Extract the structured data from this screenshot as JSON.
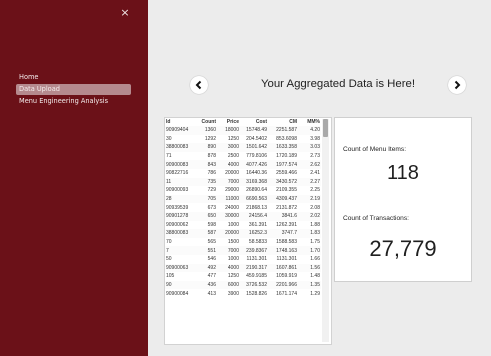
{
  "sidebar": {
    "close_glyph": "×",
    "items": [
      {
        "label": "Home",
        "active": false
      },
      {
        "label": "Data Upload",
        "active": true
      },
      {
        "label": "Menu Engineering Analysis",
        "active": false
      }
    ]
  },
  "header": {
    "title": "Your Aggregated Data is Here!",
    "prev_icon": "chevron-left-icon",
    "next_icon": "chevron-right-icon"
  },
  "table": {
    "columns": [
      "Id",
      "Count",
      "Price",
      "Cost",
      "CM",
      "MM%"
    ],
    "rows": [
      [
        "90909404",
        "1360",
        "18000",
        "15748.49",
        "2251.587",
        "4.20"
      ],
      [
        "30",
        "1292",
        "1250",
        "204.5402",
        "853.6098",
        "3.98"
      ],
      [
        "38800083",
        "890",
        "3000",
        "1501.642",
        "1633.358",
        "3.03"
      ],
      [
        "71",
        "878",
        "2500",
        "779.8106",
        "1720.189",
        "2.73"
      ],
      [
        "90900083",
        "843",
        "4000",
        "4077.426",
        "1977.574",
        "2.62"
      ],
      [
        "90822716",
        "786",
        "20000",
        "16440.36",
        "2559.466",
        "2.41"
      ],
      [
        "11",
        "735",
        "7000",
        "3169.368",
        "3430.572",
        "2.27"
      ],
      [
        "90900093",
        "729",
        "29000",
        "26890.64",
        "2109.355",
        "2.25"
      ],
      [
        "28",
        "705",
        "11000",
        "6690.563",
        "4309.437",
        "2.19"
      ],
      [
        "90939539",
        "673",
        "24000",
        "21868.13",
        "2131.872",
        "2.08"
      ],
      [
        "90901278",
        "650",
        "30000",
        "24156.4",
        "3841.6",
        "2.02"
      ],
      [
        "90900062",
        "598",
        "1000",
        "361.391",
        "1262.391",
        "1.88"
      ],
      [
        "38800083",
        "587",
        "20000",
        "16252.3",
        "3747.7",
        "1.83"
      ],
      [
        "70",
        "565",
        "1500",
        "58.5833",
        "1588.583",
        "1.75"
      ],
      [
        "7",
        "551",
        "7000",
        "239.8367",
        "1748.163",
        "1.70"
      ],
      [
        "50",
        "546",
        "1000",
        "1131.301",
        "1131.301",
        "1.66"
      ],
      [
        "90900063",
        "492",
        "4000",
        "2190.317",
        "1607.861",
        "1.56"
      ],
      [
        "105",
        "477",
        "1250",
        "459.9185",
        "1059.919",
        "1.48"
      ],
      [
        "90",
        "436",
        "6000",
        "3726.532",
        "2201.966",
        "1.35"
      ],
      [
        "90900084",
        "413",
        "3900",
        "1528.826",
        "1671.174",
        "1.29"
      ]
    ]
  },
  "stats": {
    "menu_items_label": "Count of Menu Items:",
    "menu_items_value": "118",
    "transactions_label": "Count of Transactions:",
    "transactions_value": "27,779"
  },
  "colors": {
    "sidebar_bg": "#6b1118",
    "active_item_bg": "#b58a8e",
    "main_bg": "#ececec"
  }
}
